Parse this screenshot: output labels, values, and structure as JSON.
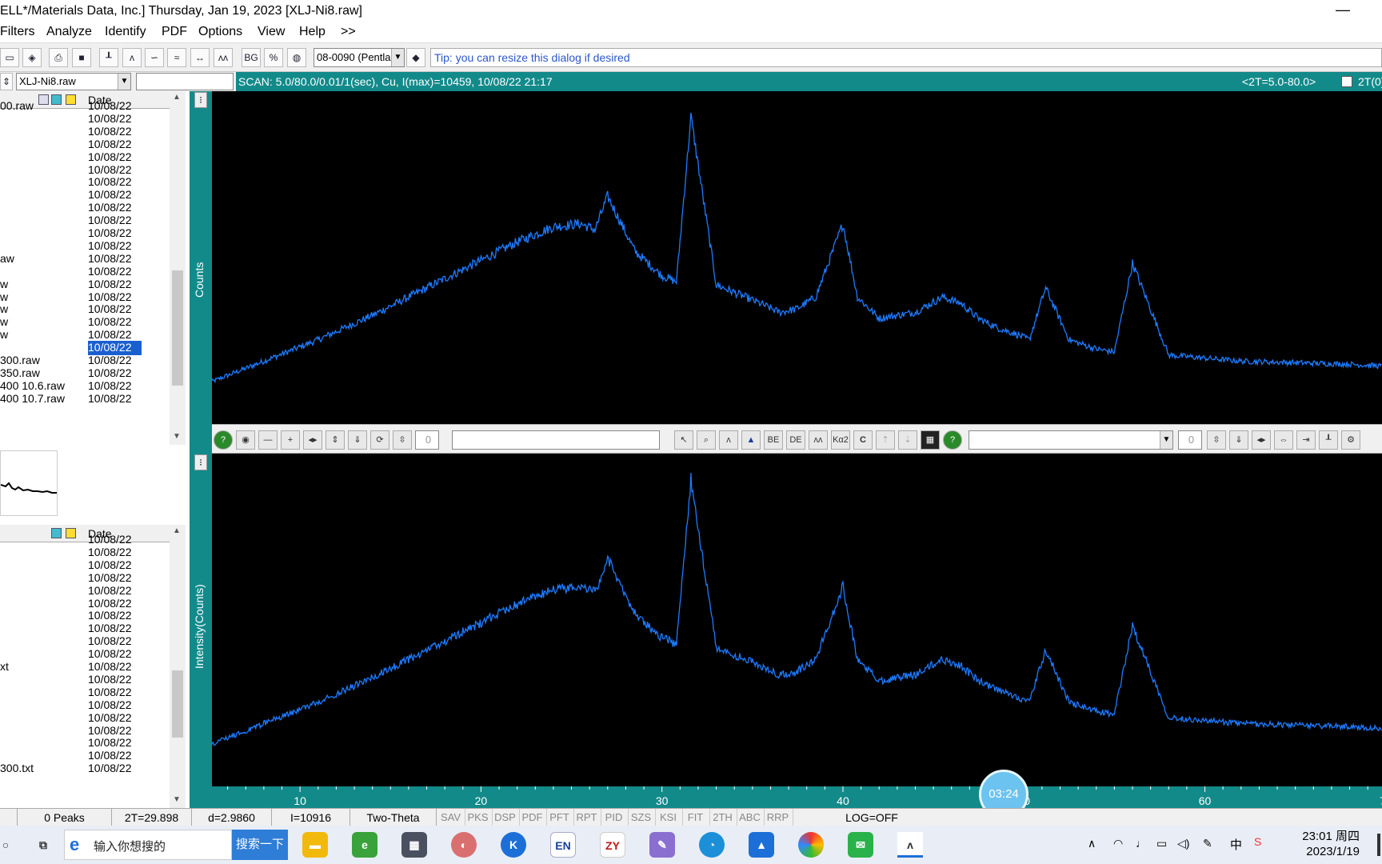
{
  "window": {
    "title": "ELL*/Materials Data, Inc.] Thursday, Jan 19, 2023 [XLJ-Ni8.raw]",
    "minimize": "—"
  },
  "menu": [
    "Filters",
    "Analyze",
    "Identify",
    "PDF",
    "Options",
    "View",
    "Help",
    ">>"
  ],
  "toolbar": {
    "pdf_combo": "08-0090 (Pentla",
    "tip": "Tip: you can resize this dialog if desired",
    "icons": [
      "open-icon",
      "diamond-icon",
      "print-icon",
      "save-icon",
      "bar-chart-icon",
      "peak-icon",
      "smooth-icon",
      "wave-icon",
      "fit-arrows-icon",
      "multi-peak-icon",
      "bg-icon",
      "percent-icon",
      "globe-icon"
    ],
    "bg_label": "BG",
    "pct_label": "%"
  },
  "file_combo": "XLJ-Ni8.raw",
  "scan": {
    "info": "SCAN: 5.0/80.0/0.01/1(sec), Cu, I(max)=10459, 10/08/22 21:17",
    "range": "<2T=5.0-80.0>",
    "checkbox_label": "2T(0)"
  },
  "file_list": {
    "date_header": "Date",
    "rows": [
      {
        "name": "00.raw",
        "date": "10/08/22"
      },
      {
        "name": "",
        "date": "10/08/22"
      },
      {
        "name": "",
        "date": "10/08/22"
      },
      {
        "name": "",
        "date": "10/08/22"
      },
      {
        "name": "",
        "date": "10/08/22"
      },
      {
        "name": "",
        "date": "10/08/22"
      },
      {
        "name": "",
        "date": "10/08/22"
      },
      {
        "name": "",
        "date": "10/08/22"
      },
      {
        "name": "",
        "date": "10/08/22"
      },
      {
        "name": "",
        "date": "10/08/22"
      },
      {
        "name": "",
        "date": "10/08/22"
      },
      {
        "name": "",
        "date": "10/08/22"
      },
      {
        "name": "aw",
        "date": "10/08/22"
      },
      {
        "name": "",
        "date": "10/08/22"
      },
      {
        "name": "w",
        "date": "10/08/22"
      },
      {
        "name": "w",
        "date": "10/08/22"
      },
      {
        "name": "w",
        "date": "10/08/22"
      },
      {
        "name": "w",
        "date": "10/08/22"
      },
      {
        "name": "w",
        "date": "10/08/22"
      },
      {
        "name": "",
        "date": "10/08/22",
        "selected": true
      },
      {
        "name": "300.raw",
        "date": "10/08/22"
      },
      {
        "name": "350.raw",
        "date": "10/08/22"
      },
      {
        "name": "400 10.6.raw",
        "date": "10/08/22"
      },
      {
        "name": "400 10.7.raw",
        "date": "10/08/22"
      }
    ]
  },
  "file_list2": {
    "date_header": "Date",
    "rows": [
      {
        "name": "",
        "date": "10/08/22"
      },
      {
        "name": "",
        "date": "10/08/22"
      },
      {
        "name": "",
        "date": "10/08/22"
      },
      {
        "name": "",
        "date": "10/08/22"
      },
      {
        "name": "",
        "date": "10/08/22"
      },
      {
        "name": "",
        "date": "10/08/22"
      },
      {
        "name": "",
        "date": "10/08/22"
      },
      {
        "name": "",
        "date": "10/08/22"
      },
      {
        "name": "",
        "date": "10/08/22"
      },
      {
        "name": "",
        "date": "10/08/22"
      },
      {
        "name": "xt",
        "date": "10/08/22"
      },
      {
        "name": "",
        "date": "10/08/22"
      },
      {
        "name": "",
        "date": "10/08/22"
      },
      {
        "name": "",
        "date": "10/08/22"
      },
      {
        "name": "",
        "date": "10/08/22"
      },
      {
        "name": "",
        "date": "10/08/22"
      },
      {
        "name": "",
        "date": "10/08/22"
      },
      {
        "name": "",
        "date": "10/08/22"
      },
      {
        "name": "300.txt",
        "date": "10/08/22"
      }
    ]
  },
  "plots": {
    "top_ylabel": "Counts",
    "bottom_ylabel": "Intensity(Counts)",
    "peak_values": [
      "0",
      "0"
    ]
  },
  "chart_data": {
    "type": "line",
    "xlabel": "",
    "xlim": [
      5,
      80
    ],
    "x_ticks": [
      10,
      20,
      30,
      40,
      50,
      60,
      70
    ],
    "y_ticks": [],
    "color": "#1e7bff",
    "background": "#000000",
    "x": [
      5,
      8,
      11,
      14,
      17,
      20,
      22,
      24,
      25.5,
      26.3,
      27,
      28.5,
      30,
      30.8,
      31.6,
      33,
      35,
      36.5,
      37.4,
      38.5,
      40,
      40.8,
      42,
      44,
      45.5,
      46.5,
      47.5,
      48.5,
      49.5,
      50.3,
      51.2,
      52.5,
      54,
      55,
      56,
      58,
      60,
      62,
      65,
      68,
      71,
      74,
      77,
      80
    ],
    "y": [
      1200,
      1900,
      2600,
      3400,
      4300,
      5200,
      5800,
      6300,
      6400,
      6200,
      7300,
      5500,
      4700,
      4500,
      9900,
      4400,
      3900,
      3500,
      3600,
      4000,
      6400,
      4000,
      3300,
      3500,
      4000,
      3800,
      3300,
      3000,
      2800,
      2600,
      4300,
      2600,
      2300,
      2200,
      5100,
      2100,
      2000,
      1900,
      1850,
      1800,
      1700,
      1650,
      1600,
      1600
    ]
  },
  "midbar": {
    "peak_field": "0",
    "right_field": "0",
    "be_label": "BE",
    "de_label": "DE",
    "ka_label": "Kα2",
    "c_label": "C"
  },
  "clock": "03:24",
  "status": {
    "peaks": "0 Peaks",
    "two_theta": "2T=29.898",
    "d_spacing": "d=2.9860",
    "intensity": "I=10916",
    "mode": "Two-Theta",
    "buttons": [
      "SAV",
      "PKS",
      "DSP",
      "PDF",
      "PFT",
      "RPT",
      "PID",
      "SZS",
      "KSI",
      "FIT",
      "2TH",
      "ABC",
      "RRP"
    ],
    "log": "LOG=OFF"
  },
  "taskbar": {
    "search_placeholder": "输入你想搜的",
    "search_button": "搜索一下",
    "time": "23:01 周四",
    "date": "2023/1/19",
    "ime": "中",
    "apps": [
      "EN",
      "ZY",
      "K"
    ]
  }
}
